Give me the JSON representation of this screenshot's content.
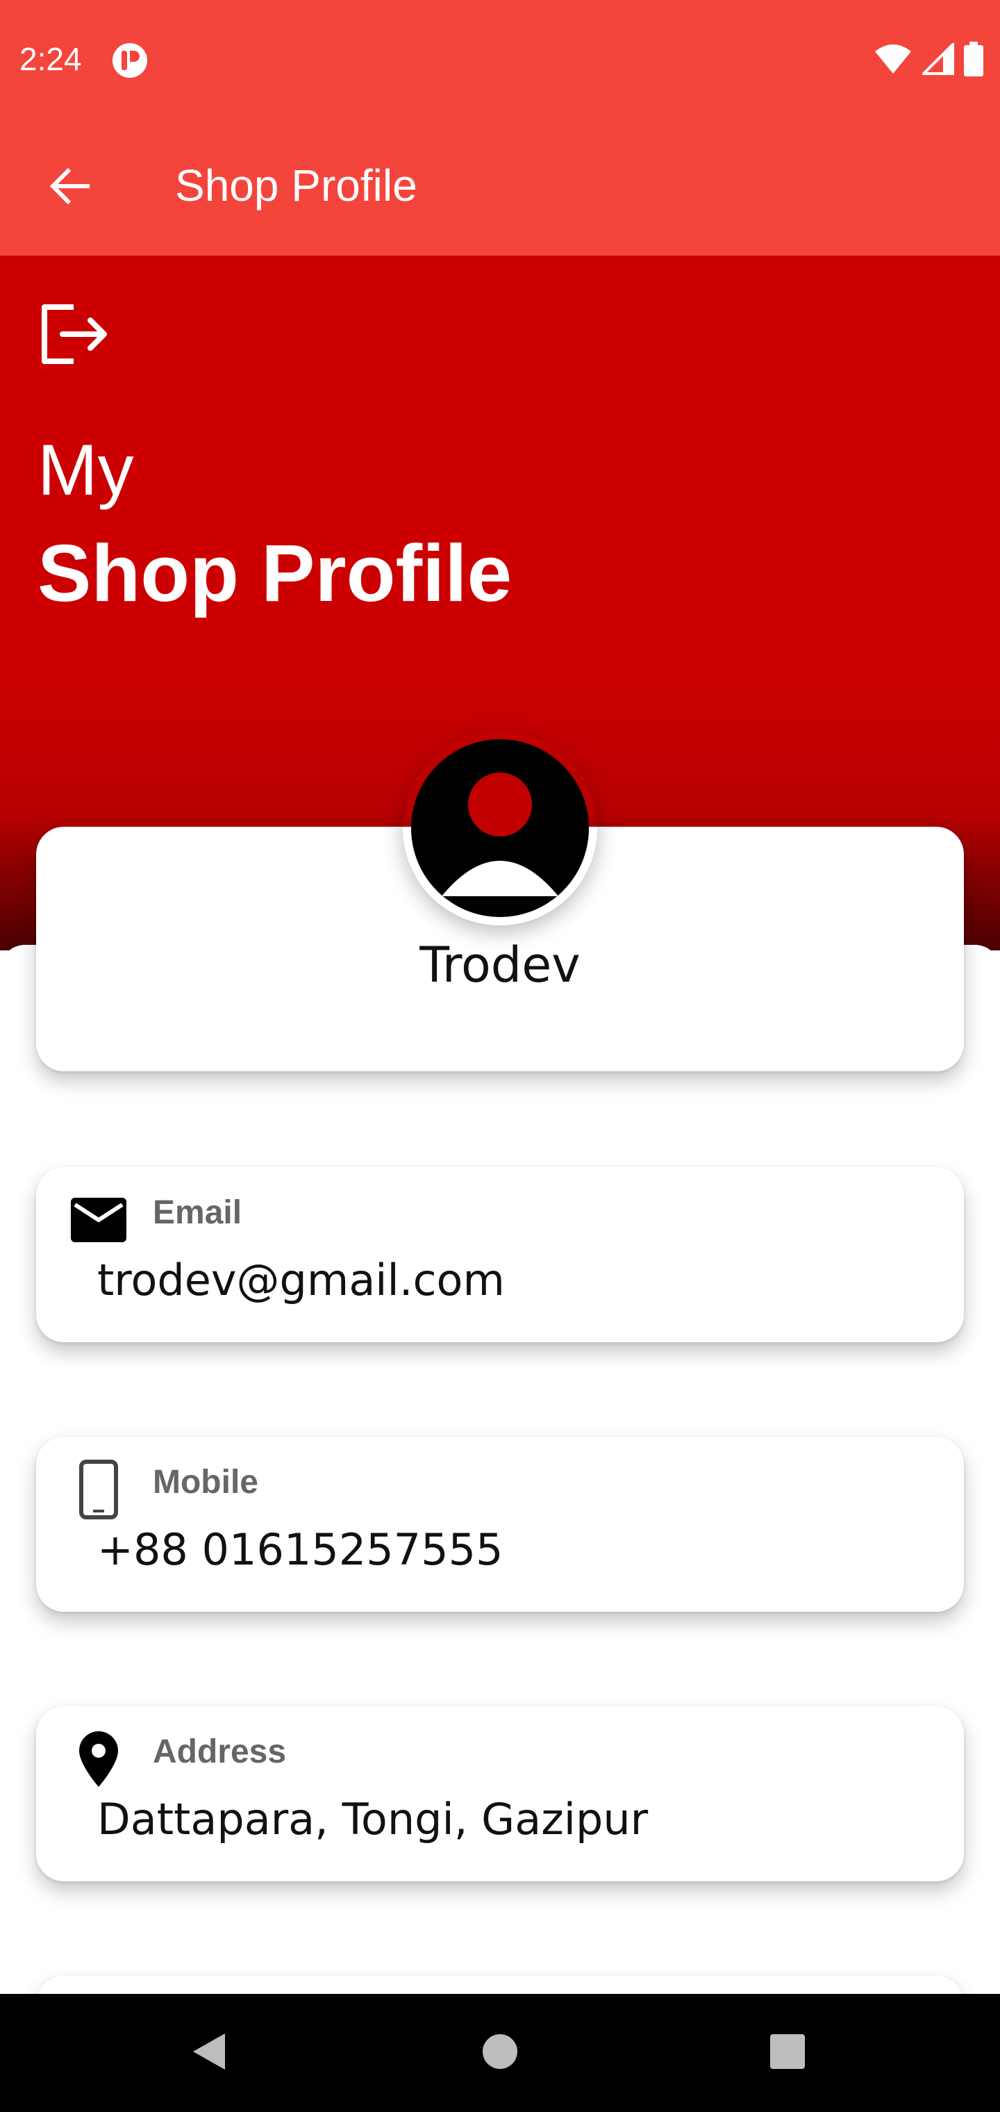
{
  "status_bar": {
    "time": "2:24",
    "icons": [
      "app-notification-icon",
      "wifi-icon",
      "signal-icon",
      "battery-icon"
    ]
  },
  "app_bar": {
    "title": "Shop Profile",
    "back_icon": "arrow-left-icon"
  },
  "header": {
    "logout_icon": "logout-icon",
    "heading_line1": "My",
    "heading_line2": "Shop Profile"
  },
  "profile": {
    "avatar_icon": "account-circle-icon",
    "name": "Trodev"
  },
  "info": [
    {
      "icon": "email-icon",
      "label": "Email",
      "value": "trodev@gmail.com"
    },
    {
      "icon": "phone-icon",
      "label": "Mobile",
      "value": "+88 01615257555"
    },
    {
      "icon": "location-pin-icon",
      "label": "Address",
      "value": "Dattapara, Tongi, Gazipur"
    }
  ],
  "nav_bar": {
    "icons": [
      "nav-back-icon",
      "nav-home-icon",
      "nav-recents-icon"
    ]
  },
  "colors": {
    "app_bar": "#f4453c",
    "header": "#cc0000",
    "label_gray": "#666666"
  }
}
